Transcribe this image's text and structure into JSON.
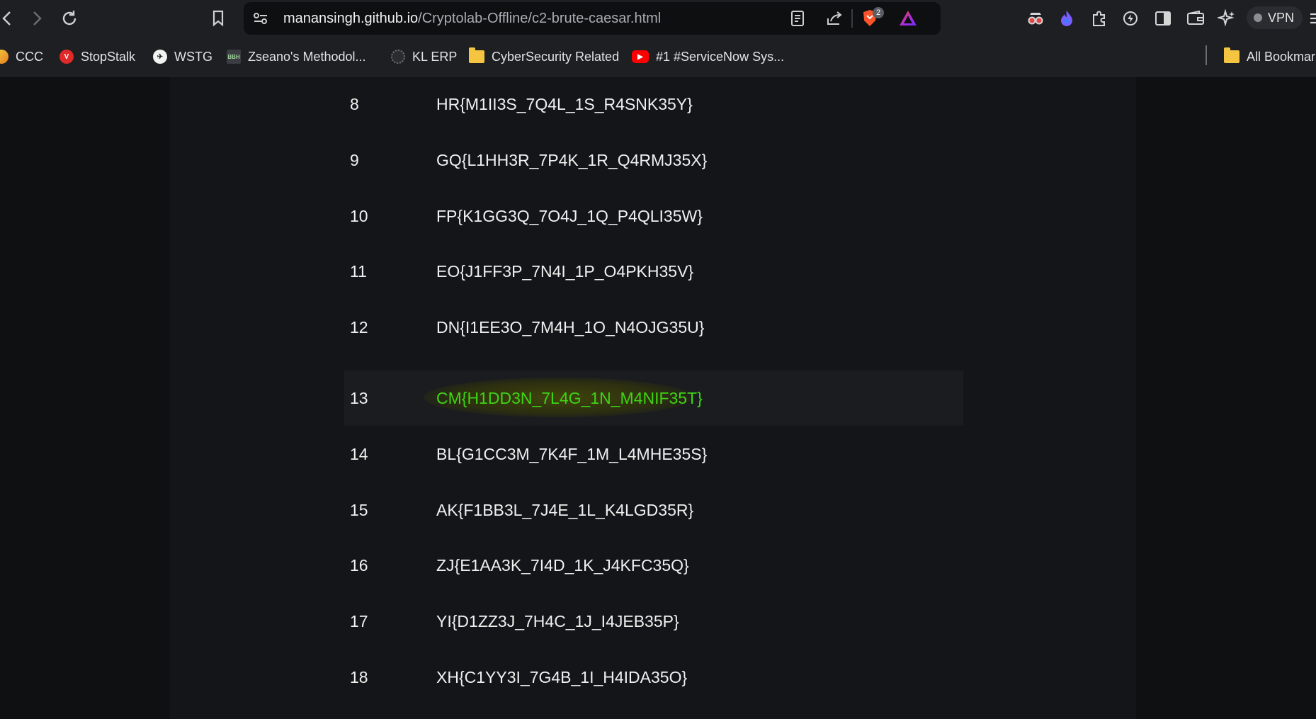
{
  "browser": {
    "url_host": "manansingh.github.io",
    "url_path": "/Cryptolab-Offline/c2-brute-caesar.html",
    "brave_badge_count": "2",
    "vpn_label": "VPN"
  },
  "bookmarks": [
    {
      "label": "CCC"
    },
    {
      "label": "StopStalk"
    },
    {
      "label": "WSTG"
    },
    {
      "label": "Zseano's Methodol..."
    },
    {
      "label": "KL ERP"
    },
    {
      "label": "CyberSecurity Related"
    },
    {
      "label": "#1 #ServiceNow Sys..."
    },
    {
      "label": "All Bookmar"
    }
  ],
  "results": {
    "highlight_key": "13",
    "rows": [
      {
        "key": "8",
        "text": "HR{M1II3S_7Q4L_1S_R4SNK35Y}"
      },
      {
        "key": "9",
        "text": "GQ{L1HH3R_7P4K_1R_Q4RMJ35X}"
      },
      {
        "key": "10",
        "text": "FP{K1GG3Q_7O4J_1Q_P4QLI35W}"
      },
      {
        "key": "11",
        "text": "EO{J1FF3P_7N4I_1P_O4PKH35V}"
      },
      {
        "key": "12",
        "text": "DN{I1EE3O_7M4H_1O_N4OJG35U}"
      },
      {
        "key": "13",
        "text": "CM{H1DD3N_7L4G_1N_M4NIF35T}"
      },
      {
        "key": "14",
        "text": "BL{G1CC3M_7K4F_1M_L4MHE35S}"
      },
      {
        "key": "15",
        "text": "AK{F1BB3L_7J4E_1L_K4LGD35R}"
      },
      {
        "key": "16",
        "text": "ZJ{E1AA3K_7I4D_1K_J4KFC35Q}"
      },
      {
        "key": "17",
        "text": "YI{D1ZZ3J_7H4C_1J_I4JEB35P}"
      },
      {
        "key": "18",
        "text": "XH{C1YY3I_7G4B_1I_H4IDA35O}"
      }
    ]
  }
}
